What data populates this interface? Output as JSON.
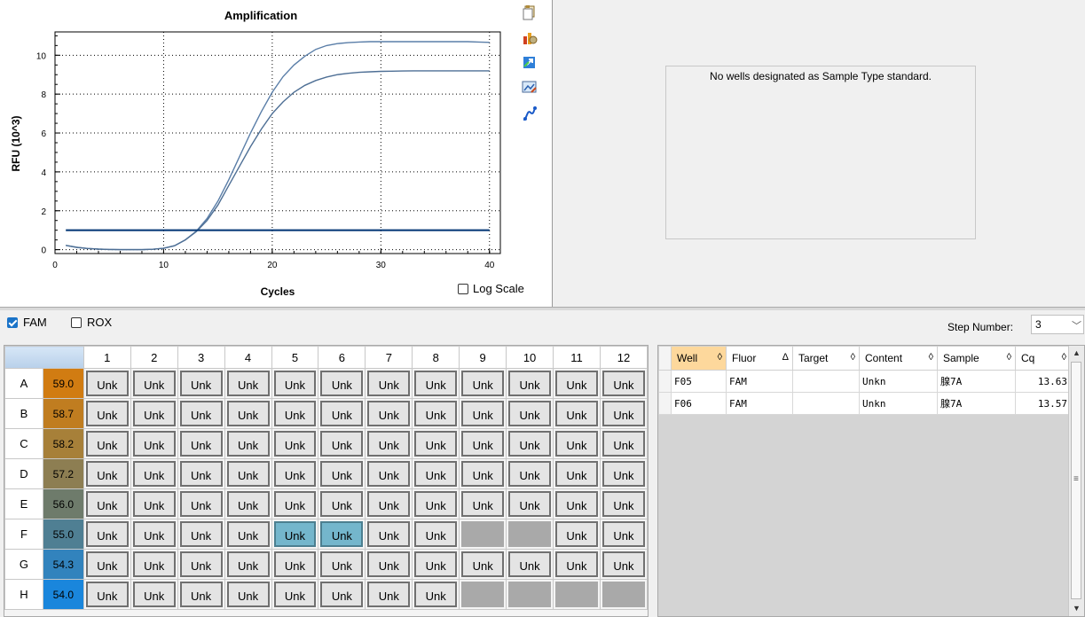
{
  "chart": {
    "title": "Amplification",
    "xlabel": "Cycles",
    "ylabel": "RFU (10^3)",
    "log_scale_label": "Log Scale",
    "log_scale_checked": false
  },
  "chart_data": {
    "type": "line",
    "title": "Amplification",
    "xlabel": "Cycles",
    "ylabel": "RFU (10^3)",
    "xlim": [
      0,
      41
    ],
    "ylim": [
      -0.2,
      11.2
    ],
    "xticks": [
      0,
      10,
      20,
      30,
      40
    ],
    "yticks": [
      0,
      2,
      4,
      6,
      8,
      10
    ],
    "grid": true,
    "x": [
      1,
      2,
      3,
      4,
      5,
      6,
      7,
      8,
      9,
      10,
      11,
      12,
      13,
      14,
      15,
      16,
      17,
      18,
      19,
      20,
      21,
      22,
      23,
      24,
      25,
      26,
      27,
      28,
      29,
      30,
      31,
      32,
      33,
      34,
      35,
      36,
      37,
      38,
      39,
      40
    ],
    "series": [
      {
        "values": [
          0.22,
          0.12,
          0.06,
          0.03,
          0.01,
          0.0,
          0.0,
          0.0,
          0.02,
          0.07,
          0.2,
          0.5,
          0.95,
          1.6,
          2.5,
          3.6,
          4.8,
          6.0,
          7.1,
          8.1,
          8.9,
          9.5,
          9.95,
          10.3,
          10.5,
          10.6,
          10.65,
          10.68,
          10.7,
          10.7,
          10.7,
          10.7,
          10.7,
          10.7,
          10.7,
          10.7,
          10.7,
          10.7,
          10.68,
          10.66
        ]
      },
      {
        "values": [
          0.22,
          0.12,
          0.06,
          0.03,
          0.01,
          0.0,
          0.0,
          0.0,
          0.02,
          0.07,
          0.2,
          0.5,
          0.92,
          1.5,
          2.3,
          3.3,
          4.3,
          5.3,
          6.2,
          7.0,
          7.6,
          8.1,
          8.45,
          8.7,
          8.88,
          9.0,
          9.07,
          9.12,
          9.15,
          9.17,
          9.18,
          9.19,
          9.2,
          9.2,
          9.2,
          9.2,
          9.2,
          9.2,
          9.2,
          9.2
        ]
      },
      {
        "values": [
          1.0,
          1.0,
          1.0,
          1.0,
          1.0,
          1.0,
          1.0,
          1.0,
          1.0,
          1.0,
          1.0,
          1.0,
          1.0,
          1.0,
          1.0,
          1.0,
          1.0,
          1.0,
          1.0,
          1.0,
          1.0,
          1.0,
          1.0,
          1.0,
          1.0,
          1.0,
          1.0,
          1.0,
          1.0,
          1.0,
          1.0,
          1.0,
          1.0,
          1.0,
          1.0,
          1.0,
          1.0,
          1.0,
          1.0,
          1.0
        ]
      }
    ],
    "colors": [
      "#5a7ea8",
      "#4e6f95",
      "#0b3d7a"
    ]
  },
  "toolbar_icons": [
    "copy-icon",
    "chart-settings-icon",
    "export-icon",
    "image-icon",
    "trace-icon"
  ],
  "std_curve": {
    "message": "No wells designated as Sample Type standard."
  },
  "fluors": [
    {
      "label": "FAM",
      "checked": true
    },
    {
      "label": "ROX",
      "checked": false
    }
  ],
  "step": {
    "label": "Step Number:",
    "value": "3"
  },
  "plate": {
    "columns": [
      "1",
      "2",
      "3",
      "4",
      "5",
      "6",
      "7",
      "8",
      "9",
      "10",
      "11",
      "12"
    ],
    "rows": [
      {
        "label": "A",
        "temp": "59.0",
        "color": "#d17c12",
        "wells": [
          "Unk",
          "Unk",
          "Unk",
          "Unk",
          "Unk",
          "Unk",
          "Unk",
          "Unk",
          "Unk",
          "Unk",
          "Unk",
          "Unk"
        ]
      },
      {
        "label": "B",
        "temp": "58.7",
        "color": "#c07d20",
        "wells": [
          "Unk",
          "Unk",
          "Unk",
          "Unk",
          "Unk",
          "Unk",
          "Unk",
          "Unk",
          "Unk",
          "Unk",
          "Unk",
          "Unk"
        ]
      },
      {
        "label": "C",
        "temp": "58.2",
        "color": "#a78039",
        "wells": [
          "Unk",
          "Unk",
          "Unk",
          "Unk",
          "Unk",
          "Unk",
          "Unk",
          "Unk",
          "Unk",
          "Unk",
          "Unk",
          "Unk"
        ]
      },
      {
        "label": "D",
        "temp": "57.2",
        "color": "#8d7e52",
        "wells": [
          "Unk",
          "Unk",
          "Unk",
          "Unk",
          "Unk",
          "Unk",
          "Unk",
          "Unk",
          "Unk",
          "Unk",
          "Unk",
          "Unk"
        ]
      },
      {
        "label": "E",
        "temp": "56.0",
        "color": "#6e7b6b",
        "wells": [
          "Unk",
          "Unk",
          "Unk",
          "Unk",
          "Unk",
          "Unk",
          "Unk",
          "Unk",
          "Unk",
          "Unk",
          "Unk",
          "Unk"
        ]
      },
      {
        "label": "F",
        "temp": "55.0",
        "color": "#4f7f93",
        "wells": [
          "Unk",
          "Unk",
          "Unk",
          "Unk",
          "Unk",
          "Unk",
          "Unk",
          "Unk",
          "",
          "",
          "Unk",
          "Unk"
        ]
      },
      {
        "label": "G",
        "temp": "54.3",
        "color": "#3283bd",
        "wells": [
          "Unk",
          "Unk",
          "Unk",
          "Unk",
          "Unk",
          "Unk",
          "Unk",
          "Unk",
          "Unk",
          "Unk",
          "Unk",
          "Unk"
        ]
      },
      {
        "label": "H",
        "temp": "54.0",
        "color": "#1a86dc",
        "wells": [
          "Unk",
          "Unk",
          "Unk",
          "Unk",
          "Unk",
          "Unk",
          "Unk",
          "Unk",
          "",
          "",
          "",
          ""
        ]
      }
    ],
    "selected": [
      [
        5,
        4
      ],
      [
        5,
        5
      ]
    ]
  },
  "results": {
    "columns": [
      {
        "label": "Well",
        "sort": "◊",
        "sorted": true
      },
      {
        "label": "Fluor",
        "sort": "Δ",
        "sorted": false
      },
      {
        "label": "Target",
        "sort": "◊",
        "sorted": false
      },
      {
        "label": "Content",
        "sort": "◊",
        "sorted": false
      },
      {
        "label": "Sample",
        "sort": "◊",
        "sorted": false
      },
      {
        "label": "Cq",
        "sort": "◊",
        "sorted": false
      }
    ],
    "rows": [
      [
        "F05",
        "FAM",
        "",
        "Unkn",
        "腺7A",
        "13.63"
      ],
      [
        "F06",
        "FAM",
        "",
        "Unkn",
        "腺7A",
        "13.57"
      ]
    ]
  }
}
